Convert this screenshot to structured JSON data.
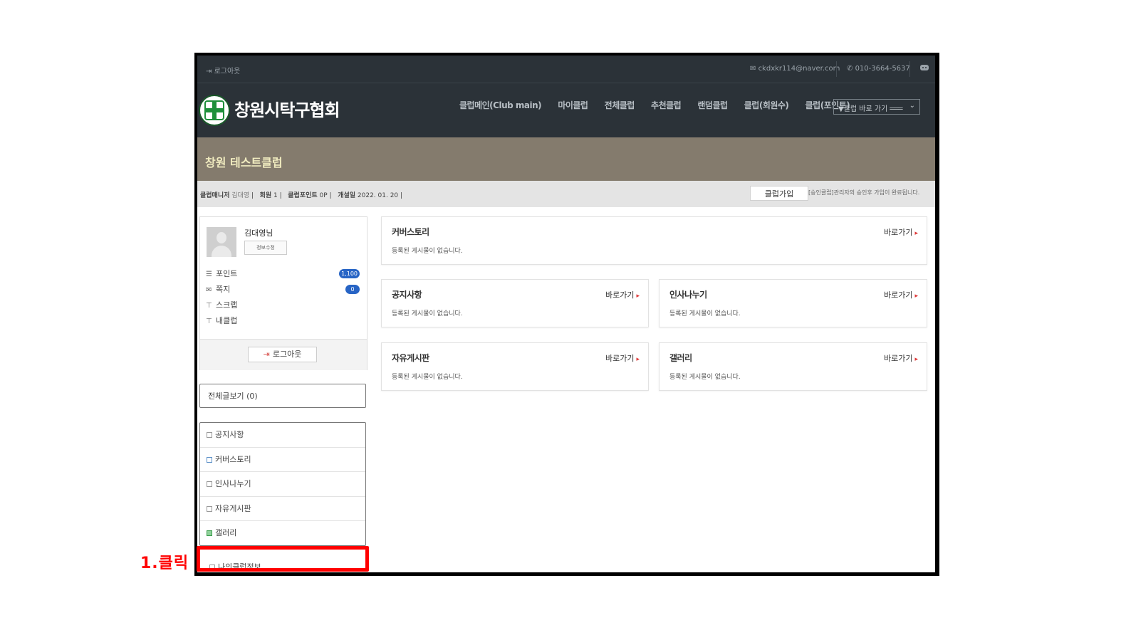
{
  "topbar": {
    "logout_label": "로그아웃",
    "email": "ckdxkr114@naver.com",
    "phone": "010-3664-5637"
  },
  "header": {
    "site_title": "창원시탁구협회",
    "nav": [
      "클럽메인(Club main)",
      "마이클럽",
      "전체클럽",
      "추천클럽",
      "랜덤클럽",
      "클럽(회원수)",
      "클럽(포인트)"
    ],
    "club_select": "▼클럽 바로 가기 ═══"
  },
  "banner": {
    "club_name": "창원 테스트클럽"
  },
  "infobar": {
    "manager_label": "클럽매니저",
    "manager_value": "김대영",
    "members_label": "회원",
    "members_value": "1",
    "points_label": "클럽포인트",
    "points_value": "0P",
    "opened_label": "개설일",
    "opened_value": "2022. 01. 20",
    "join_button": "클럽가입",
    "join_note": "[승인클럽]관리자의 승인후 가입이 완료됩니다."
  },
  "profile": {
    "name": "김대영님",
    "edit_button": "정보수정",
    "items": [
      {
        "label": "포인트",
        "badge": "1,100"
      },
      {
        "label": "쪽지",
        "badge": "0"
      },
      {
        "label": "스크랩",
        "badge": ""
      },
      {
        "label": "내클럽",
        "badge": ""
      }
    ],
    "logout_button": "로그아웃"
  },
  "sidebar": {
    "all_posts": "전체글보기 (0)",
    "boards": [
      "공지사항",
      "커버스토리",
      "인사나누기",
      "자유게시판",
      "갤러리"
    ],
    "my_club_info": "나의클럽정보"
  },
  "panels": {
    "go_label": "바로가기",
    "empty_text": "등록된 게시물이 없습니다.",
    "cover": "커버스토리",
    "notice": "공지사항",
    "greeting": "인사나누기",
    "free": "자유게시판",
    "gallery": "갤러리"
  },
  "annotation": {
    "click_label": "1.클릭",
    "color": "#ff0000"
  }
}
